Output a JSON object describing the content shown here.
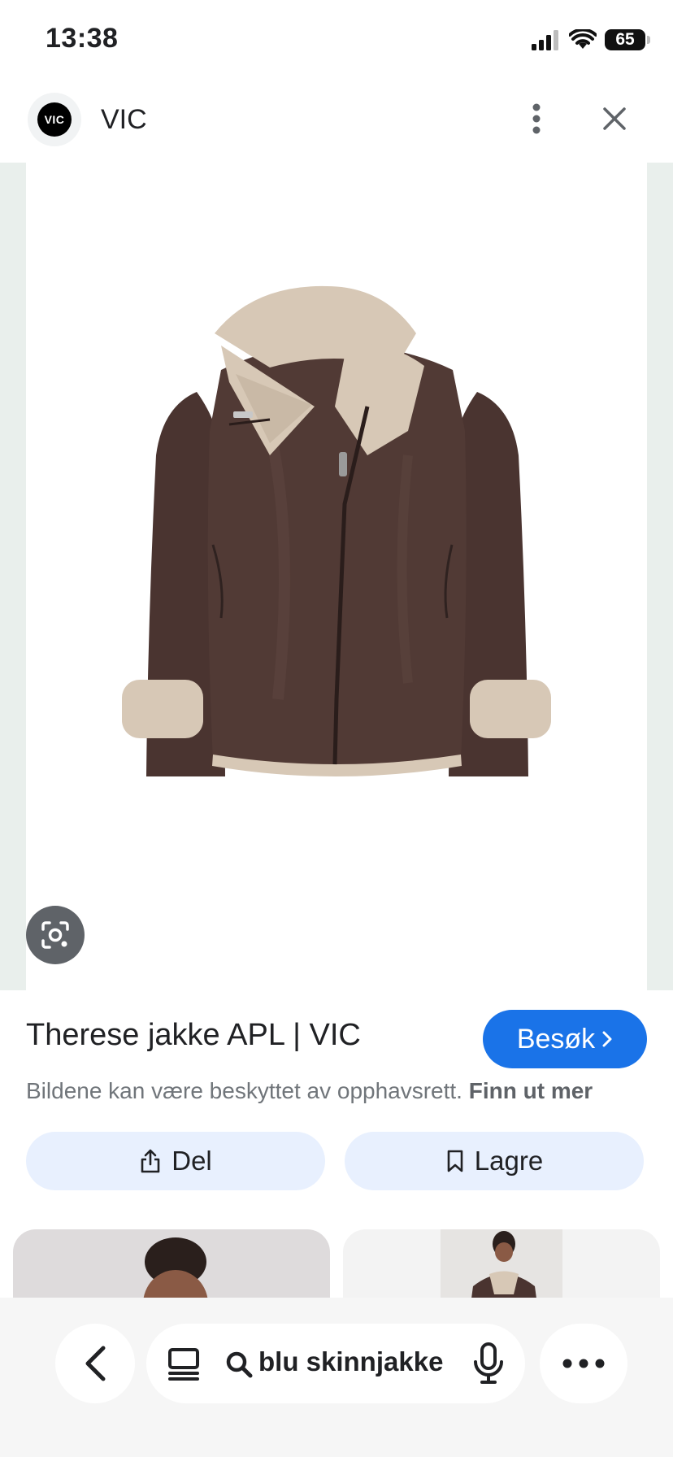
{
  "status_bar": {
    "time": "13:38",
    "battery": "65"
  },
  "header": {
    "logo_text": "VIC",
    "source_name": "VIC"
  },
  "result": {
    "title": "Therese jakke APL | VIC",
    "visit_label": "Besøk",
    "copyright_text": "Bildene kan være beskyttet av opphavsrett.",
    "learn_more_label": "Finn ut mer"
  },
  "actions": {
    "share_label": "Del",
    "save_label": "Lagre"
  },
  "bottom_bar": {
    "query": "blu skinnjakke"
  },
  "colors": {
    "accent": "#1a73e8",
    "action_bg": "#e8f0fe",
    "jacket": "#4a3430",
    "shearling": "#d7c8b6"
  },
  "icons": [
    "signal-icon",
    "wifi-icon",
    "more-vert-icon",
    "close-icon",
    "lens-icon",
    "share-icon",
    "bookmark-icon",
    "back-icon",
    "tabs-icon",
    "search-icon",
    "mic-icon",
    "more-horiz-icon"
  ]
}
